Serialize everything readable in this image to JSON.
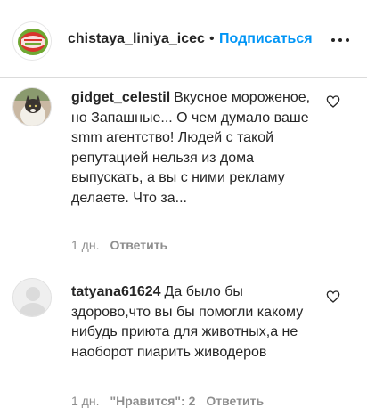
{
  "header": {
    "username": "chistaya_liniya_icec",
    "separator": "•",
    "follow_label": "Подписаться",
    "more_icon": "more-horizontal-icon"
  },
  "comments": [
    {
      "author": "gidget_celestil",
      "text": "Вкусное мороженое, но Запашные... О чем думало ваше smm агентство! Людей с такой репутацией нельзя из дома выпускать, а вы с ними рекламу делаете. Что за...",
      "time": "1 дн.",
      "likes": "",
      "reply_label": "Ответить",
      "like_icon": "heart-outline-icon"
    },
    {
      "author": "tatyana61624",
      "text": "Да было бы здорово,что вы бы помогли какому нибудь приюта для животных,а не наоборот пиарить живодеров",
      "time": "1 дн.",
      "likes": "\"Нравится\": 2",
      "reply_label": "Ответить",
      "like_icon": "heart-outline-icon"
    }
  ],
  "colors": {
    "link": "#0095f6",
    "text": "#262626",
    "meta": "#8e8e8e",
    "divider": "#dbdbdb"
  }
}
